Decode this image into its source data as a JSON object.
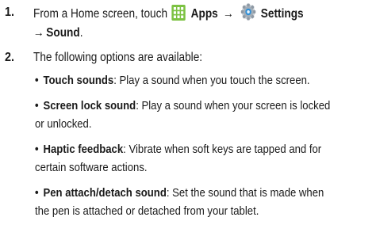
{
  "step1": {
    "number": "1.",
    "prefix": "From a Home screen, touch",
    "apps_label": "Apps",
    "arrow": "→",
    "settings_label": "Settings",
    "arrow2": "→",
    "sound_label": "Sound",
    "period": ".",
    "apps_icon": "apps-grid-icon",
    "settings_icon": "gear-icon",
    "apps_icon_color": "#7cc242",
    "settings_icon_color": "#9aa4ae"
  },
  "step2": {
    "number": "2.",
    "text": "The following options are available:"
  },
  "options": [
    {
      "term": "Touch sounds",
      "line1": ": Play a sound when you touch the screen.",
      "line2": ""
    },
    {
      "term": "Screen lock sound",
      "line1": ": Play a sound when your screen is locked",
      "line2": "or unlocked."
    },
    {
      "term": "Haptic feedback",
      "line1": ": Vibrate when soft keys are tapped and for",
      "line2": "certain software actions."
    },
    {
      "term": "Pen attach/detach sound",
      "line1": ": Set the sound that is made when",
      "line2": "the pen is attached or detached from your tablet."
    }
  ]
}
